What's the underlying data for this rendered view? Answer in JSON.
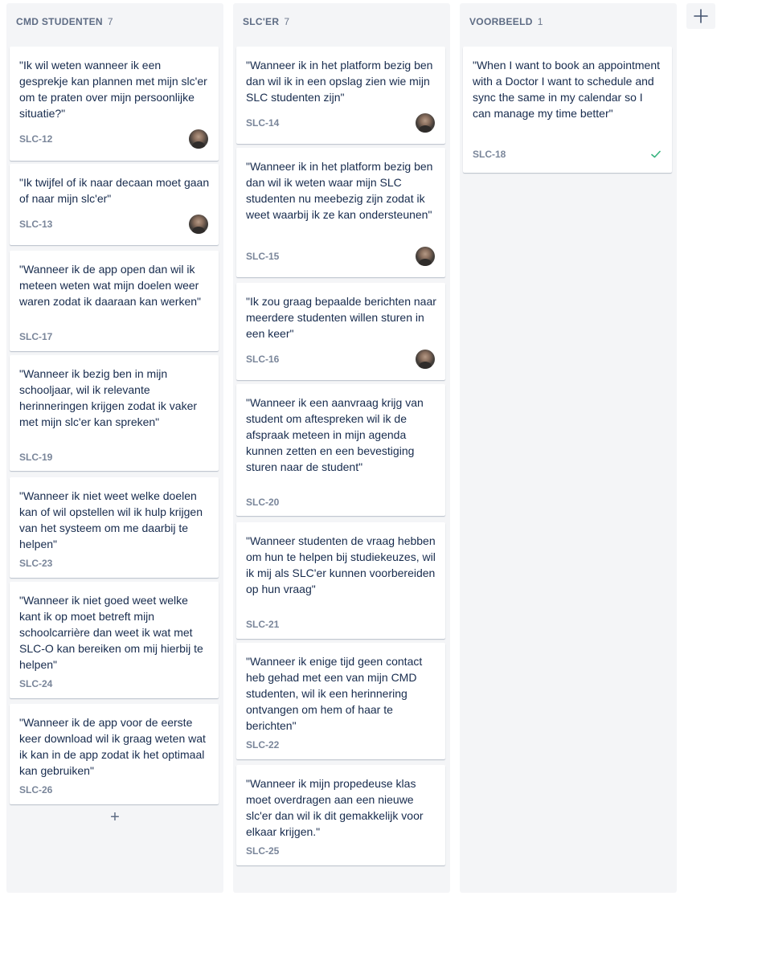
{
  "columns": [
    {
      "title": "CMD STUDENTEN",
      "count": "7",
      "cards": [
        {
          "text": "\"Ik wil weten wanneer ik een gesprekje kan plannen met mijn slc'er om te praten over mijn persoonlijke situatie?\"",
          "key": "SLC-12",
          "avatar": true
        },
        {
          "text": "\"Ik twijfel of ik naar decaan moet gaan of naar mijn slc'er\"",
          "key": "SLC-13",
          "avatar": true
        },
        {
          "text": "\"Wanneer ik de app open dan wil ik meteen weten wat mijn doelen weer waren zodat ik daaraan kan werken\"",
          "key": "SLC-17"
        },
        {
          "text": "\"Wanneer ik bezig ben in mijn schooljaar, wil ik relevante herinneringen krijgen zodat ik vaker met mijn slc'er kan spreken\"",
          "key": "SLC-19"
        },
        {
          "text": "\"Wanneer ik niet weet welke doelen kan of wil opstellen wil ik hulp krijgen van het systeem om me daarbij te helpen\"",
          "key": "SLC-23"
        },
        {
          "text": "\"Wanneer ik niet goed weet welke kant ik op moet betreft mijn schoolcarrière dan weet ik wat met SLC-O kan bereiken om mij hierbij te helpen\"",
          "key": "SLC-24"
        },
        {
          "text": "\"Wanneer ik de app voor de eerste keer download wil ik graag weten wat ik kan in de app zodat ik het optimaal kan gebruiken\"",
          "key": "SLC-26"
        }
      ]
    },
    {
      "title": "SLC'ER",
      "count": "7",
      "cards": [
        {
          "text": "\"Wanneer ik in het platform bezig ben dan wil ik in een opslag zien wie mijn SLC studenten zijn\"",
          "key": "SLC-14",
          "avatar": true
        },
        {
          "text": "\"Wanneer ik in het platform bezig ben dan wil ik weten waar mijn SLC studenten nu meebezig zijn zodat ik weet waarbij ik ze kan ondersteunen\"",
          "key": "SLC-15",
          "avatar": true
        },
        {
          "text": "\"Ik zou graag bepaalde berichten naar meerdere studenten willen sturen in een keer\"",
          "key": "SLC-16",
          "avatar": true
        },
        {
          "text": "\"Wanneer ik een aanvraag krijg van student om aftespreken wil ik de afspraak meteen in mijn agenda kunnen zetten en een bevestiging sturen naar de student\"",
          "key": "SLC-20"
        },
        {
          "text": "\"Wanneer studenten de vraag hebben om hun te helpen bij studiekeuzes, wil ik mij als SLC'er kunnen voorbereiden op hun vraag\"",
          "key": "SLC-21"
        },
        {
          "text": "\"Wanneer ik enige tijd geen contact heb gehad met een van mijn CMD studenten, wil ik een herinnering ontvangen om hem of haar te berichten\"",
          "key": "SLC-22"
        },
        {
          "text": "\"Wanneer ik mijn propedeuse klas moet overdragen aan een nieuwe slc'er dan wil ik dit gemakkelijk voor elkaar krijgen.\"",
          "key": "SLC-25"
        }
      ]
    },
    {
      "title": "VOORBEELD",
      "count": "1",
      "cards": [
        {
          "text": "\"When I want to book an appointment with a Doctor I want to schedule and sync the same in my calendar so I can manage my time better\"",
          "key": "SLC-18",
          "done": true
        }
      ]
    }
  ],
  "icons": {
    "add_card": "plus-icon",
    "add_column": "plus-icon",
    "done": "check-icon",
    "assignee": "avatar"
  },
  "colors": {
    "column_bg": "#f4f5f7",
    "text": "#172b4d",
    "key": "#7a869a",
    "done": "#36b37e"
  },
  "add_card_glyph": "+"
}
